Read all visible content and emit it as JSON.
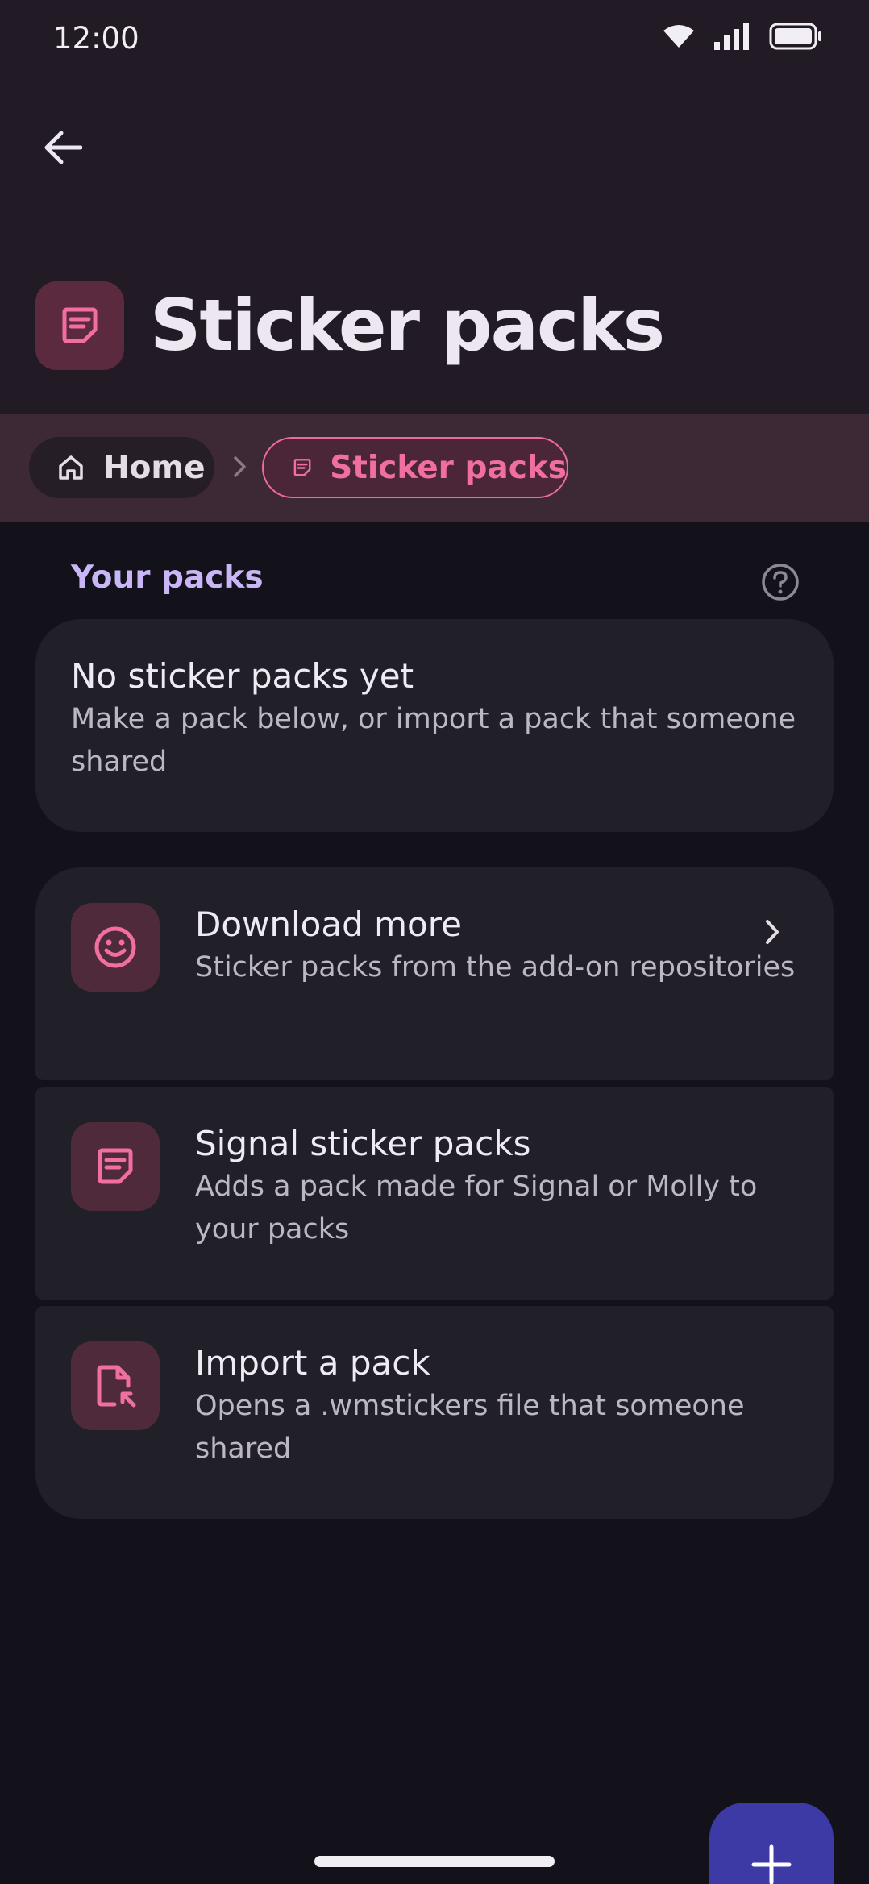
{
  "status_bar": {
    "time": "12:00"
  },
  "header": {
    "title": "Sticker packs"
  },
  "breadcrumb": {
    "home": "Home",
    "current": "Sticker packs"
  },
  "section": {
    "title": "Your packs"
  },
  "empty_state": {
    "title": "No sticker packs yet",
    "subtitle": "Make a pack below, or import a pack that someone shared"
  },
  "options": [
    {
      "title": "Download more",
      "subtitle": "Sticker packs from the add-on repositories",
      "icon": "smiley-icon"
    },
    {
      "title": "Signal sticker packs",
      "subtitle": "Adds a pack made for Signal or Molly to your packs",
      "icon": "sticker-icon"
    },
    {
      "title": "Import a pack",
      "subtitle": "Opens a .wmstickers file that someone shared",
      "icon": "file-import-icon"
    }
  ],
  "colors": {
    "accent_pink": "#f06ea1",
    "section_purple": "#c8b6f7",
    "fab": "#3d3aa6",
    "header_bg": "#221a24",
    "breadcrumb_bg": "#3c2935",
    "card_bg": "#212028"
  }
}
